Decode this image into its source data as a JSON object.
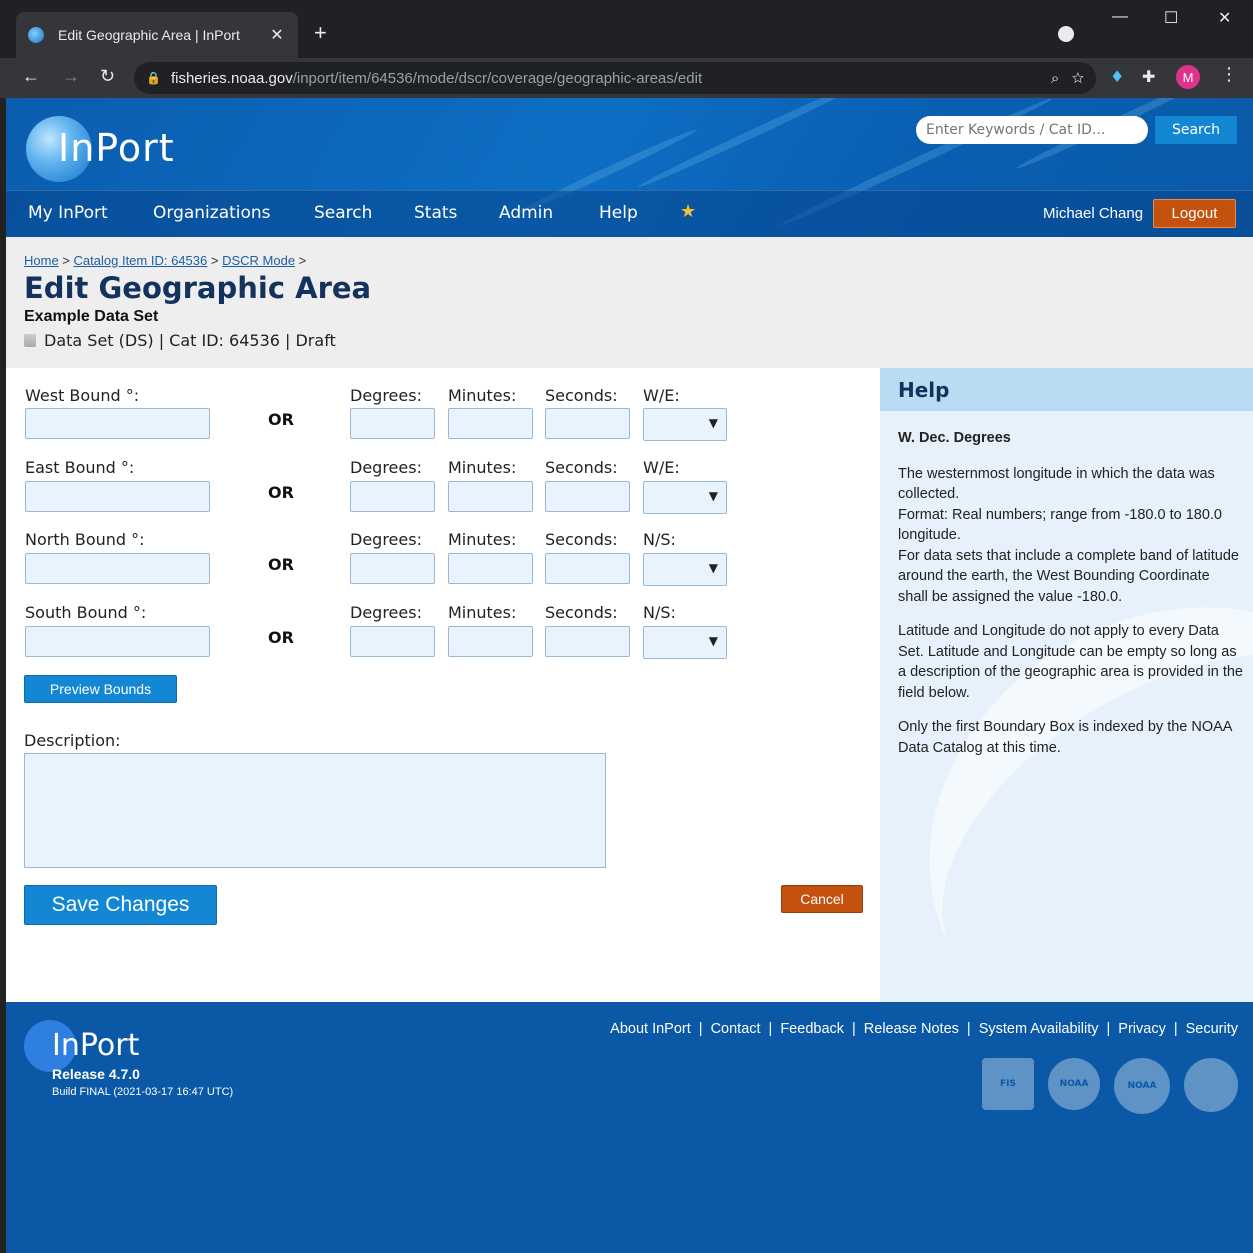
{
  "browser": {
    "tab_title": "Edit Geographic Area | InPort",
    "tab_close": "✕",
    "new_tab": "+",
    "url_host": "fisheries.noaa.gov",
    "url_path": "/inport/item/64536/mode/dscr/coverage/geographic-areas/edit",
    "avatar_letter": "M",
    "win_minimize": "—",
    "win_maximize": "☐",
    "win_close": "✕"
  },
  "header": {
    "logo": "InPort",
    "search_placeholder": "Enter Keywords / Cat ID...",
    "search_button": "Search",
    "nav": [
      "My InPort",
      "Organizations",
      "Search",
      "Stats",
      "Admin",
      "Help"
    ],
    "user_name": "Michael Chang",
    "logout": "Logout"
  },
  "page": {
    "breadcrumb": [
      "Home",
      "Catalog Item ID: 64536",
      "DSCR Mode"
    ],
    "breadcrumb_sep": ">",
    "title": "Edit Geographic Area",
    "subtitle": "Example Data Set",
    "meta": "Data Set (DS) | Cat ID: 64536 | Draft"
  },
  "form": {
    "rows": [
      {
        "label": "West Bound °:",
        "dir": "W/E:"
      },
      {
        "label": "East Bound °:",
        "dir": "W/E:"
      },
      {
        "label": "North Bound °:",
        "dir": "N/S:"
      },
      {
        "label": "South Bound °:",
        "dir": "N/S:"
      }
    ],
    "or_label": "OR",
    "degrees_label": "Degrees:",
    "minutes_label": "Minutes:",
    "seconds_label": "Seconds:",
    "preview_button": "Preview Bounds",
    "description_label": "Description:",
    "save_button": "Save Changes",
    "cancel_button": "Cancel"
  },
  "help": {
    "heading": "Help",
    "topic": "W. Dec. Degrees",
    "para1": "The westernmost longitude in which the data was collected.",
    "para1b": "Format: Real numbers; range from -180.0 to 180.0 longitude.",
    "para1c": "For data sets that include a complete band of latitude around the earth, the West Bounding Coordinate shall be assigned the value -180.0.",
    "para2": "Latitude and Longitude do not apply to every Data Set. Latitude and Longitude can be empty so long as a description of the geographic area is provided in the field below.",
    "para3": "Only the first Boundary Box is indexed by the NOAA Data Catalog at this time."
  },
  "footer": {
    "logo": "InPort",
    "release": "Release 4.7.0",
    "build": "Build FINAL (2021-03-17 16:47 UTC)",
    "links": [
      "About InPort",
      "Contact",
      "Feedback",
      "Release Notes",
      "System Availability",
      "Privacy",
      "Security"
    ],
    "link_sep": "|",
    "seal_fis": "FIS",
    "seal_noaa_fisheries": "NOAA",
    "seal_noaa": "NOAA"
  },
  "colors": {
    "brand_blue": "#0a58a6",
    "button_blue": "#1487d4",
    "logout_orange": "#c4510e",
    "input_fill": "#e8f3fd"
  }
}
